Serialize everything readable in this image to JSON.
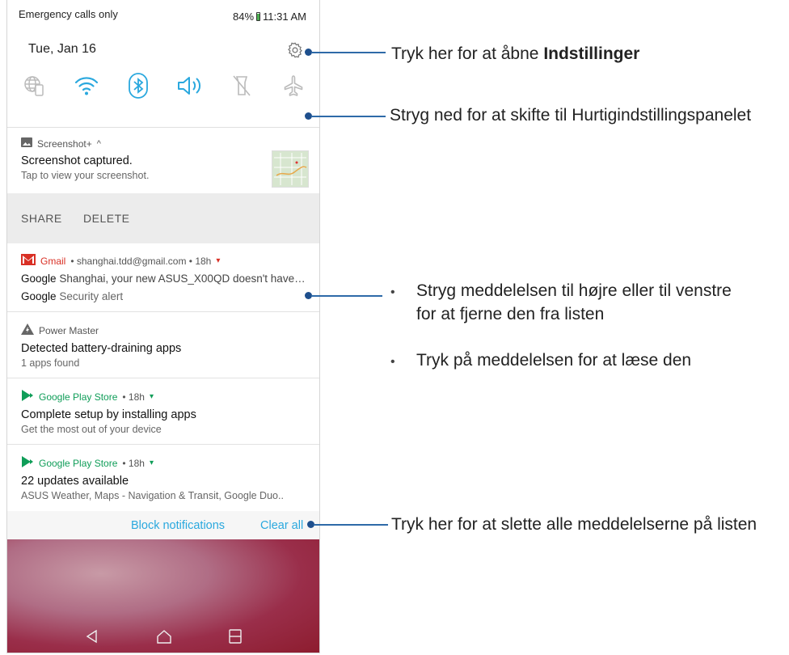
{
  "status_bar": {
    "left_text": "Emergency calls only",
    "battery_text": "84%",
    "time": "11:31 AM"
  },
  "quick_settings": {
    "date": "Tue, Jan 16",
    "icons": [
      "globe-phone-icon",
      "wifi-icon",
      "bluetooth-icon",
      "volume-icon",
      "flashlight-off-icon",
      "airplane-mode-icon"
    ]
  },
  "notifications": [
    {
      "app": "Screenshot+",
      "title": "Screenshot captured.",
      "text": "Tap to view your screenshot.",
      "icon": "image-icon"
    },
    {
      "app": "Gmail",
      "meta": "• shanghai.tdd@gmail.com • 18h",
      "lines": [
        {
          "bold": "Google",
          "text": "Shanghai, your new ASUS_X00QD doesn't have…"
        },
        {
          "bold": "Google",
          "text": "Security alert"
        }
      ],
      "icon": "gmail-icon"
    },
    {
      "app": "Power Master",
      "title": "Detected battery-draining apps",
      "text": "1 apps found",
      "icon": "power-master-icon"
    },
    {
      "app": "Google Play Store",
      "meta": "• 18h",
      "title": "Complete setup by installing apps",
      "text": "Get the most out of your device",
      "icon": "play-store-icon"
    },
    {
      "app": "Google Play Store",
      "meta": "• 18h",
      "title": "22 updates available",
      "text": "ASUS Weather, Maps - Navigation & Transit, Google Duo..",
      "icon": "play-store-icon"
    }
  ],
  "screenshot_actions": {
    "share": "SHARE",
    "delete": "DELETE"
  },
  "footer": {
    "block": "Block notifications",
    "clear": "Clear all"
  },
  "callouts": {
    "settings_prefix": "Tryk her for at åbne ",
    "settings_bold": "Indstillinger",
    "swipe_down": "Stryg ned for at skifte til Hurtigindstillingspanelet",
    "bullet1_line1": "Stryg meddelelsen til højre eller til venstre",
    "bullet1_line2": "for at fjerne den fra listen",
    "bullet2": "Tryk på meddelelsen for at læse den",
    "clear_all": "Tryk her for at slette alle meddelelserne på listen"
  },
  "colors": {
    "accent_blue": "#2aa8de",
    "callout_blue": "#1e4f8d",
    "gmail_red": "#d93025",
    "play_green": "#0f9d58"
  }
}
